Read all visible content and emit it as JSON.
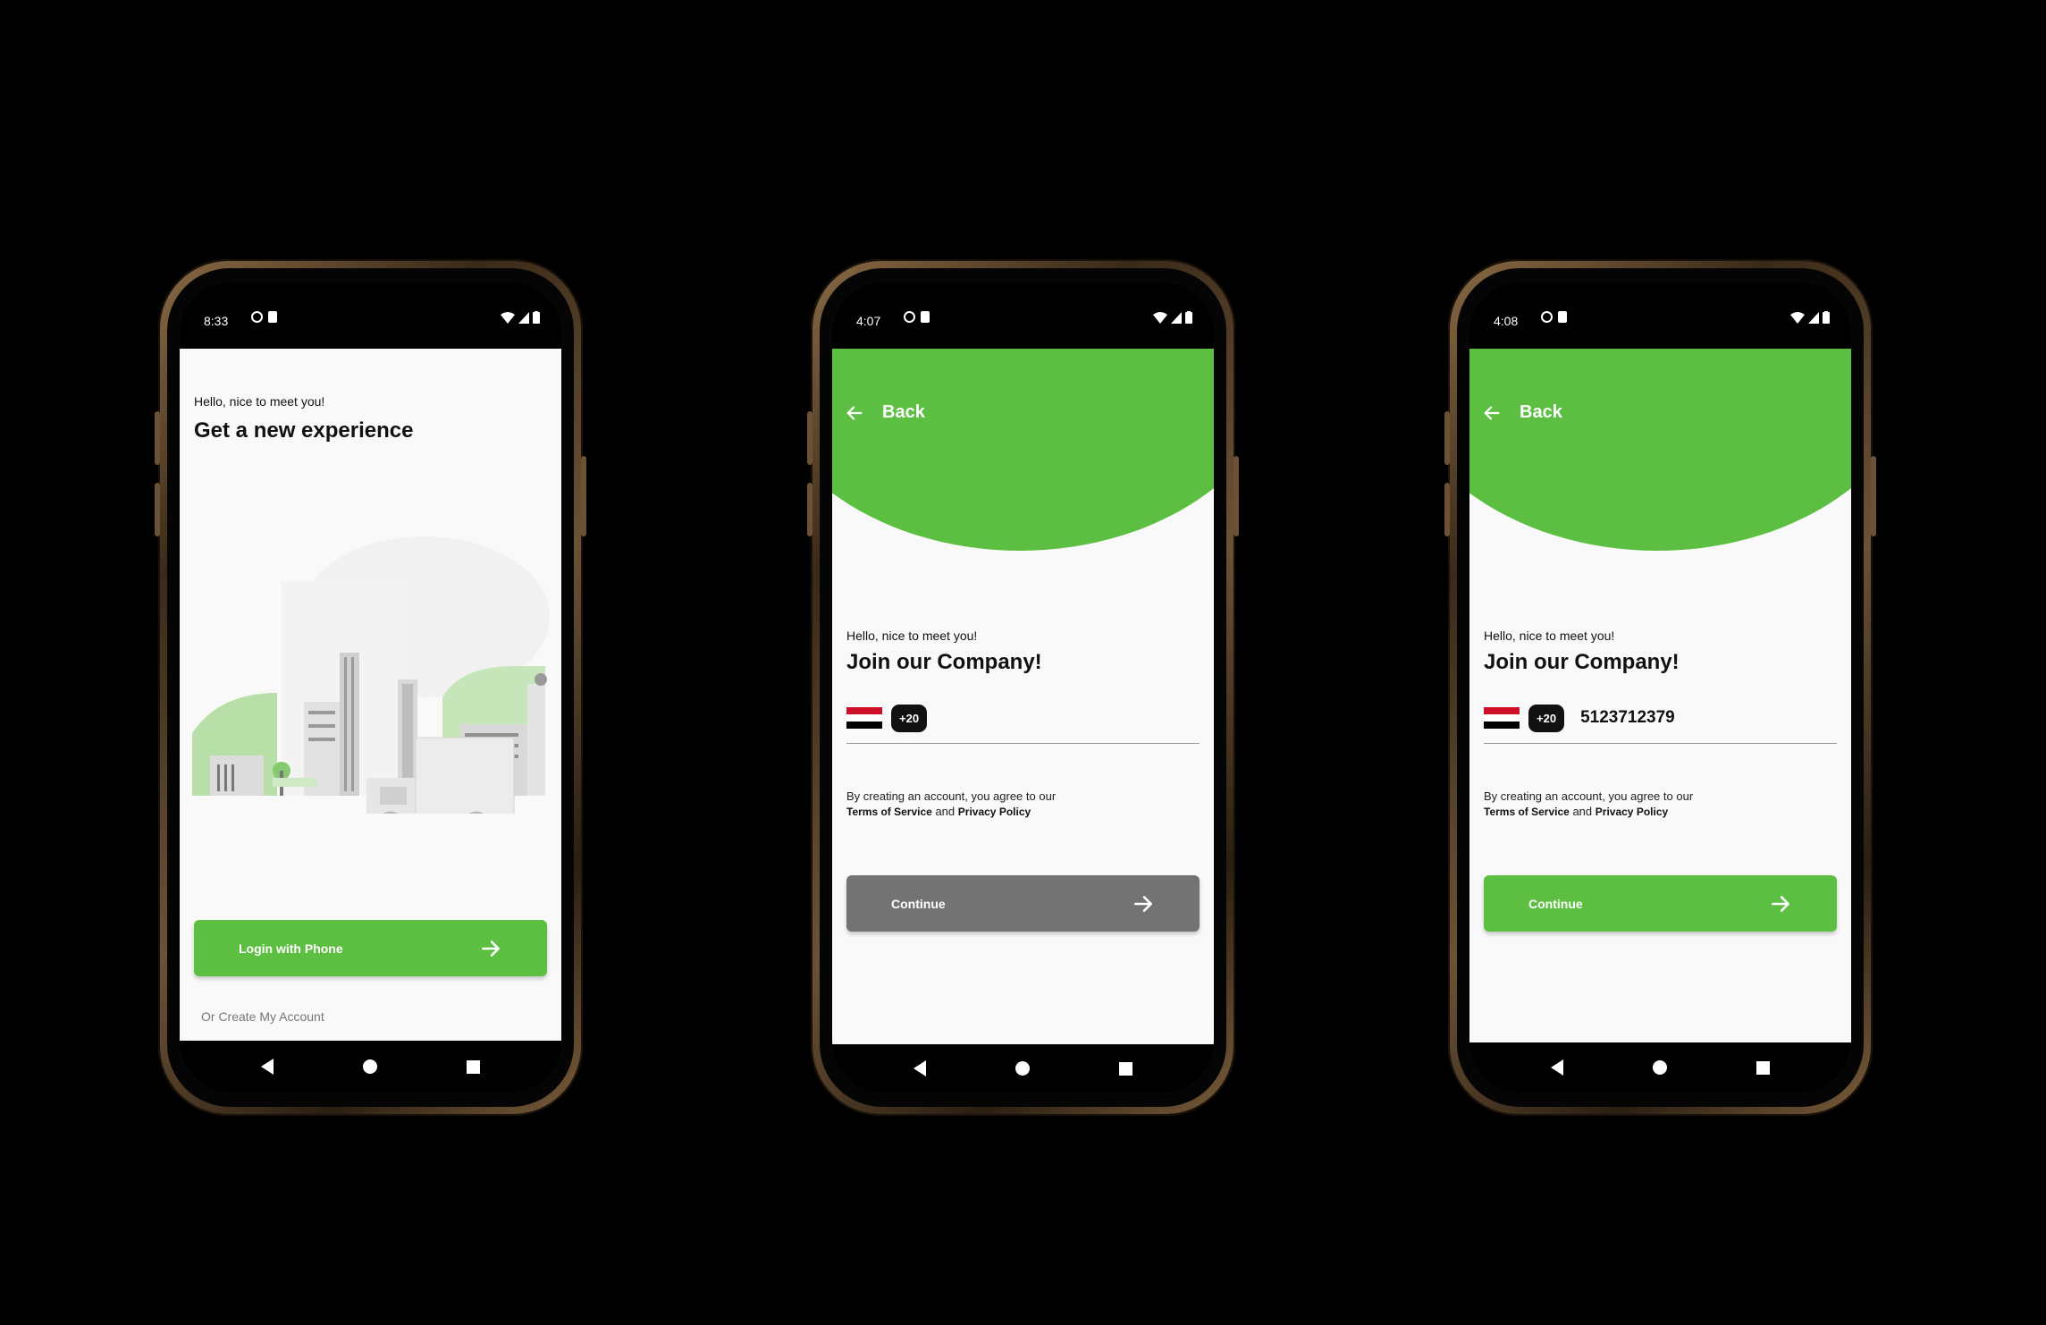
{
  "colors": {
    "accent": "#5cbf42",
    "disabled": "#737373",
    "background": "#000000"
  },
  "screens": [
    {
      "status": {
        "time": "8:33"
      },
      "greeting": "Hello, nice to meet you!",
      "title": "Get a new experience",
      "login_button": "Login with Phone",
      "create_account": "Or Create My Account"
    },
    {
      "status": {
        "time": "4:07"
      },
      "back_label": "Back",
      "greeting": "Hello, nice to meet you!",
      "title": "Join our Company!",
      "country_code": "+20",
      "phone_number": "",
      "terms_prefix": "By creating an account, you agree to our",
      "terms_link": "Terms of Service",
      "terms_and": "and",
      "privacy_link": "Privacy Policy",
      "continue_button": "Continue",
      "continue_enabled": false
    },
    {
      "status": {
        "time": "4:08"
      },
      "back_label": "Back",
      "greeting": "Hello, nice to meet you!",
      "title": "Join our Company!",
      "country_code": "+20",
      "phone_number": "5123712379",
      "terms_prefix": "By creating an account, you agree to our",
      "terms_link": "Terms of Service",
      "terms_and": "and",
      "privacy_link": "Privacy Policy",
      "continue_button": "Continue",
      "continue_enabled": true
    }
  ]
}
